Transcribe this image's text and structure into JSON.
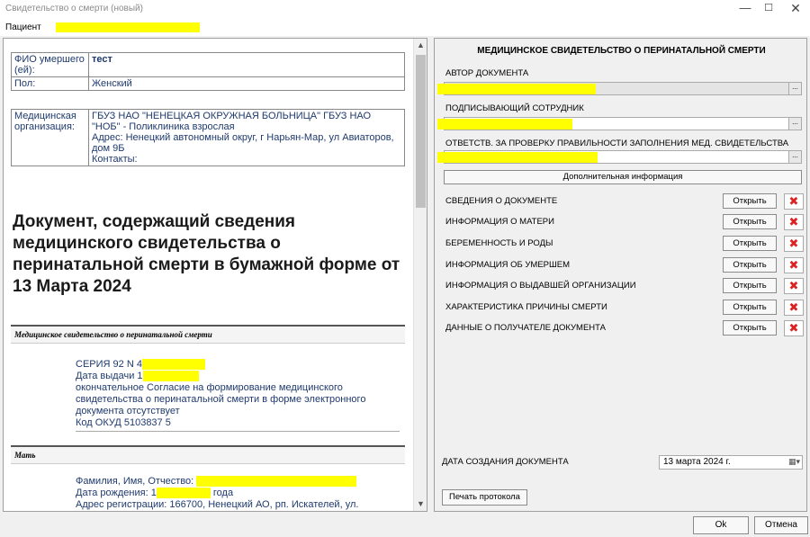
{
  "window": {
    "title": "Свидетельство о смерти (новый)",
    "min_icon": "—",
    "max_icon": "☐",
    "close_icon": "✕"
  },
  "patient": {
    "label": "Пациент"
  },
  "document": {
    "table1": [
      {
        "key": "ФИО умершего (ей):",
        "value": "тест"
      },
      {
        "key": "Пол:",
        "value": "Женский"
      }
    ],
    "table2": {
      "key": "Медицинская организация:",
      "lines": [
        "ГБУЗ НАО \"НЕНЕЦКАЯ ОКРУЖНАЯ БОЛЬНИЦА\" ГБУЗ НАО \"НОБ\" - Поликлиника взрослая",
        "Адрес: Ненецкий автономный округ, г Нарьян-Мар, ул Авиаторов, дом 9Б",
        "Контакты:"
      ]
    },
    "heading": "Документ, содержащий сведения медицинского свидетельства о перинатальной смерти в бумажной форме от 13 Марта 2024",
    "section1": {
      "title": "Медицинское свидетельство о перинатальной смерти",
      "series": "СЕРИЯ 92 N 4",
      "issue_date": "Дата выдачи 1",
      "consent": "окончательное Согласие на формирование медицинского свидетельства о перинатальной смерти в форме электронного документа отсутствует",
      "okud": "Код ОКУД 5103837 5"
    },
    "section2": {
      "title": "Мать",
      "name_label": "Фамилия, Имя, Отчество:",
      "birth_label": "Дата рождения: 1",
      "birth_suffix": "года",
      "address": "Адрес регистрации: 166700, Ненецкий АО, рп. Искателей, ул."
    },
    "scroll_up": "▲",
    "scroll_down": "▼"
  },
  "form": {
    "title": "МЕДИЦИНСКОЕ СВИДЕТЕЛЬСТВО О ПЕРИНАТАЛЬНОЙ СМЕРТИ",
    "author_label": "АВТОР ДОКУМЕНТА",
    "signer_label": "ПОДПИСЫВАЮЩИЙ СОТРУДНИК",
    "responsible_label": "ОТВЕТСТВ. ЗА ПРОВЕРКУ ПРАВИЛЬНОСТИ ЗАПОЛНЕНИЯ МЕД. СВИДЕТЕЛЬСТВА",
    "dots": "...",
    "additional_info": "Дополнительная информация",
    "open_label": "Открыть",
    "delete_icon": "✖",
    "sections": [
      "СВЕДЕНИЯ О ДОКУМЕНТЕ",
      "ИНФОРМАЦИЯ О МАТЕРИ",
      "БЕРЕМЕННОСТЬ И РОДЫ",
      "ИНФОРМАЦИЯ ОБ УМЕРШЕМ",
      "ИНФОРМАЦИЯ О ВЫДАВШЕЙ ОРГАНИЗАЦИИ",
      "ХАРАКТЕРИСТИКА ПРИЧИНЫ СМЕРТИ",
      "ДАННЫЕ О ПОЛУЧАТЕЛЕ ДОКУМЕНТА"
    ],
    "date_label": "ДАТА СОЗДАНИЯ ДОКУМЕНТА",
    "date_value": "13   марта   2024 г.",
    "calendar_icon": "▦▾",
    "print_protocol": "Печать протокола"
  },
  "footer": {
    "ok": "Ok",
    "cancel": "Отмена"
  }
}
